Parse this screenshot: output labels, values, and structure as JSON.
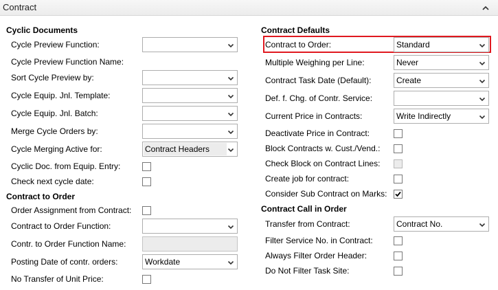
{
  "header": {
    "title": "Contract",
    "collapse_icon": "chevron-up-icon"
  },
  "left": {
    "cyclic_documents": {
      "title": "Cyclic Documents",
      "cycle_preview_function": {
        "label": "Cycle Preview Function:",
        "value": ""
      },
      "cycle_preview_function_name": {
        "label": "Cycle Preview Function Name:"
      },
      "sort_cycle_preview_by": {
        "label": "Sort Cycle Preview by:",
        "value": ""
      },
      "cycle_equip_jnl_template": {
        "label": "Cycle Equip. Jnl. Template:",
        "value": ""
      },
      "cycle_equip_jnl_batch": {
        "label": "Cycle Equip. Jnl. Batch:",
        "value": ""
      },
      "merge_cycle_orders_by": {
        "label": "Merge Cycle Orders by:",
        "value": ""
      },
      "cycle_merging_active_for": {
        "label": "Cycle Merging Active for:",
        "value": "Contract Headers"
      },
      "cyclic_doc_from_equip_entry": {
        "label": "Cyclic Doc. from Equip. Entry:",
        "checked": false
      },
      "check_next_cycle_date": {
        "label": "Check next cycle date:",
        "checked": false
      }
    },
    "contract_to_order": {
      "title": "Contract to Order",
      "order_assignment_from_contract": {
        "label": "Order Assignment from Contract:",
        "checked": false
      },
      "contract_to_order_function": {
        "label": "Contract to Order Function:",
        "value": ""
      },
      "contr_to_order_function_name": {
        "label": "Contr. to Order Function Name:",
        "value": ""
      },
      "posting_date_of_contr_orders": {
        "label": "Posting Date of contr. orders:",
        "value": "Workdate"
      },
      "no_transfer_of_unit_price": {
        "label": "No Transfer of Unit Price:",
        "checked": false
      }
    }
  },
  "right": {
    "contract_defaults": {
      "title": "Contract Defaults",
      "contract_to_order": {
        "label": "Contract to Order:",
        "value": "Standard"
      },
      "multiple_weighing_per_line": {
        "label": "Multiple Weighing per Line:",
        "value": "Never"
      },
      "contract_task_date_default": {
        "label": "Contract Task Date (Default):",
        "value": "Create"
      },
      "def_f_chg_of_contr_service": {
        "label": "Def. f. Chg. of Contr. Service:",
        "value": ""
      },
      "current_price_in_contracts": {
        "label": "Current Price in Contracts:",
        "value": "Write Indirectly"
      },
      "deactivate_price_in_contract": {
        "label": "Deactivate Price in Contract:",
        "checked": false
      },
      "block_contracts_w_cust_vend": {
        "label": "Block Contracts w. Cust./Vend.:",
        "checked": false
      },
      "check_block_on_contract_lines": {
        "label": "Check Block on Contract Lines:",
        "checked": false,
        "disabled": true
      },
      "create_job_for_contract": {
        "label": "Create job for contract:",
        "checked": false
      },
      "consider_sub_contract_on_marks": {
        "label": "Consider Sub Contract on Marks:",
        "checked": true
      }
    },
    "contract_call_in_order": {
      "title": "Contract Call in Order",
      "transfer_from_contract": {
        "label": "Transfer from Contract:",
        "value": "Contract No."
      },
      "filter_service_no_in_contract": {
        "label": "Filter Service No. in Contract:",
        "checked": false
      },
      "always_filter_order_header": {
        "label": "Always Filter Order Header:",
        "checked": false
      },
      "do_not_filter_task_site": {
        "label": "Do Not Filter Task Site:",
        "checked": false
      }
    }
  },
  "colors": {
    "highlight": "#e0181f",
    "input_border": "#adadad",
    "disabled_fill": "#ececec"
  }
}
